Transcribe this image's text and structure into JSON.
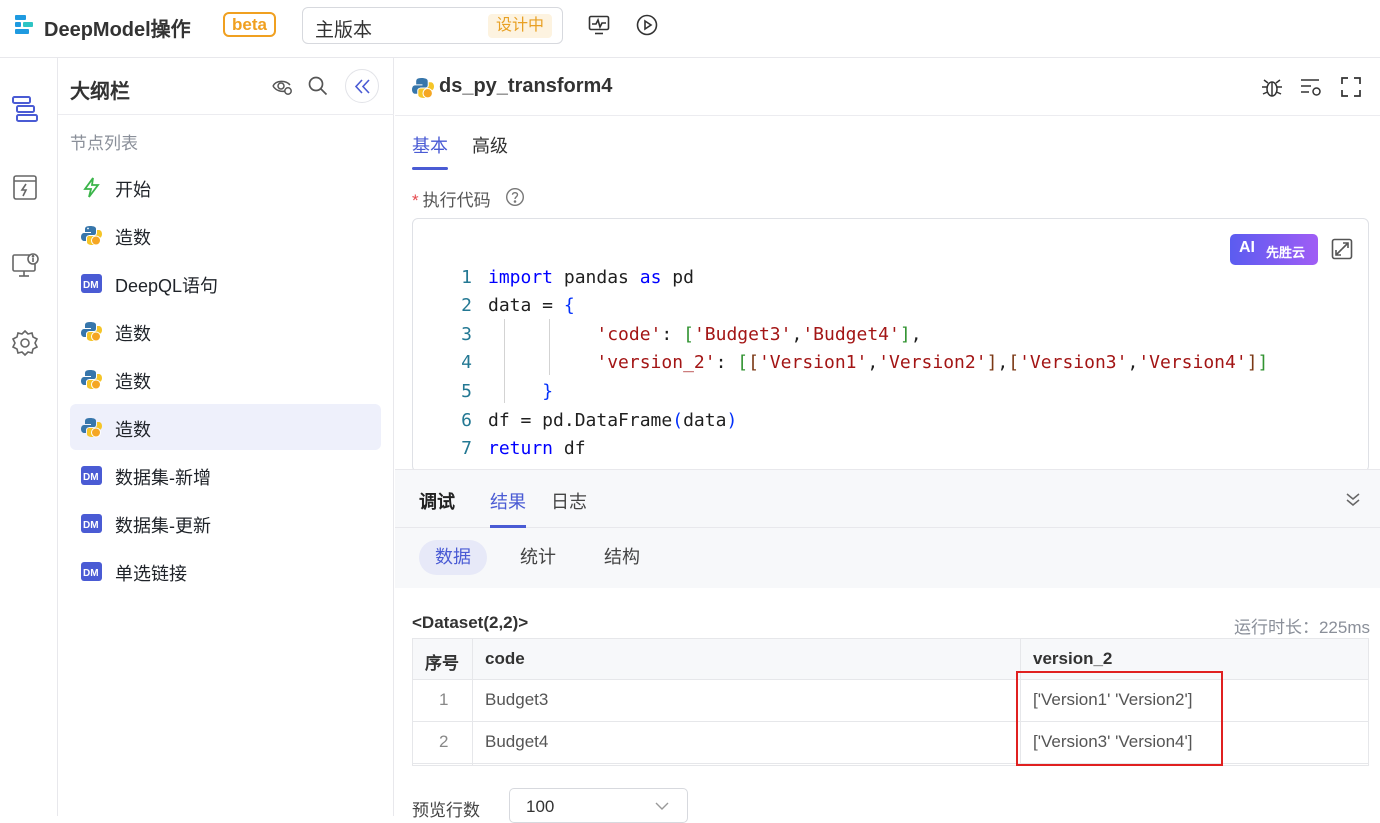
{
  "app": {
    "title": "DeepModel操作",
    "beta": "beta"
  },
  "version": {
    "name": "主版本",
    "status": "设计中"
  },
  "outline": {
    "title": "大纲栏",
    "section_label": "节点列表",
    "nodes": [
      {
        "label": "开始",
        "icon": "lightning-icon"
      },
      {
        "label": "造数",
        "icon": "python-icon"
      },
      {
        "label": "DeepQL语句",
        "icon": "dm-icon"
      },
      {
        "label": "造数",
        "icon": "python-icon"
      },
      {
        "label": "造数",
        "icon": "python-icon"
      },
      {
        "label": "造数",
        "icon": "python-icon",
        "active": true
      },
      {
        "label": "数据集-新增",
        "icon": "dm-icon"
      },
      {
        "label": "数据集-更新",
        "icon": "dm-icon"
      },
      {
        "label": "单选链接",
        "icon": "dm-icon"
      }
    ]
  },
  "node": {
    "title": "ds_py_transform4",
    "tabs": [
      "基本",
      "高级"
    ],
    "field_label": "执行代码",
    "ai_label": "AI",
    "ai_brand": "先胜云"
  },
  "code": {
    "line_numbers": [
      "1",
      "2",
      "3",
      "4",
      "5",
      "6",
      "7"
    ]
  },
  "debug": {
    "tabs": [
      "调试",
      "结果",
      "日志"
    ],
    "subtabs": [
      "数据",
      "统计",
      "结构"
    ],
    "dataset_label": "<Dataset(2,2)>",
    "runtime": "运行时长：225ms",
    "columns": [
      "序号",
      "code",
      "version_2"
    ],
    "rows": [
      [
        "1",
        "Budget3",
        "['Version1' 'Version2']"
      ],
      [
        "2",
        "Budget4",
        "['Version3' 'Version4']"
      ]
    ],
    "preview_label": "预览行数",
    "preview_value": "100"
  },
  "colors": {
    "accent": "#4a5bd4",
    "beta": "#f0a020",
    "highlight": "#e02020"
  }
}
